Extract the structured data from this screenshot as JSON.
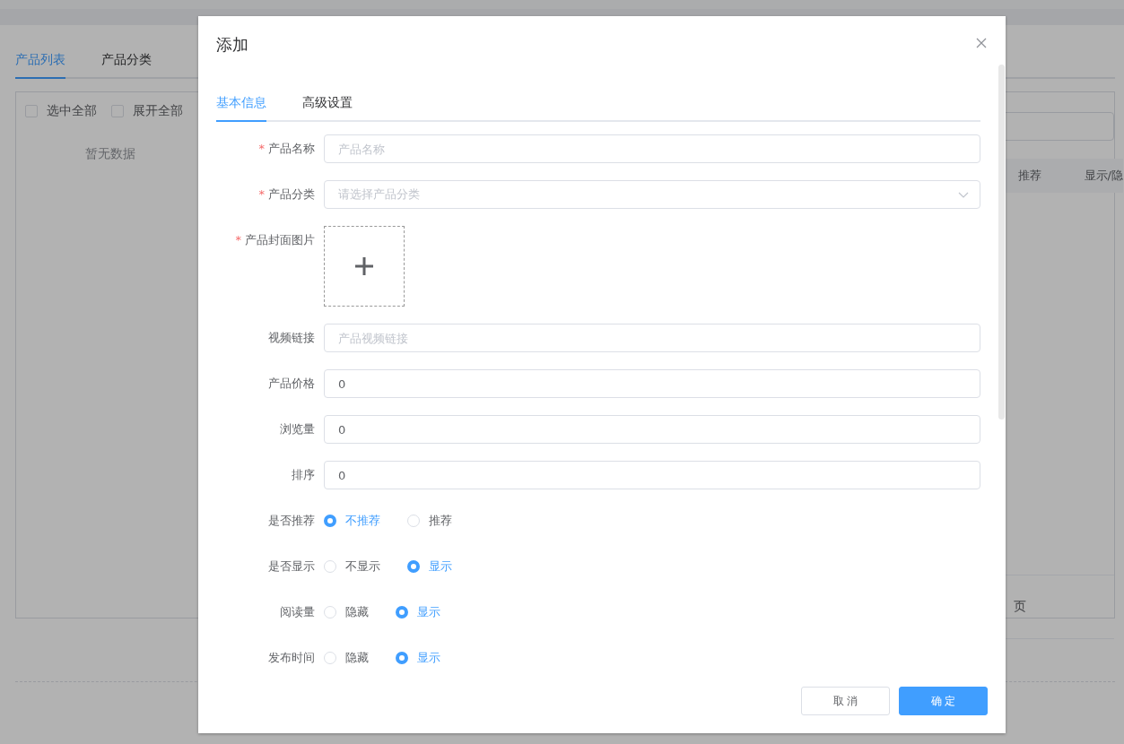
{
  "page": {
    "tabs": [
      {
        "label": "产品列表",
        "selected": true
      },
      {
        "label": "产品分类",
        "selected": false
      }
    ],
    "checkboxes": [
      {
        "label": "选中全部",
        "checked": false
      },
      {
        "label": "展开全部",
        "checked": false
      }
    ],
    "empty_text": "暂无数据",
    "table": {
      "columns": [
        "推荐",
        "显示/隐"
      ]
    },
    "pagination_text": "页"
  },
  "dialog": {
    "title": "添加",
    "required_mark": "*",
    "tabs": [
      {
        "label": "基本信息",
        "selected": true
      },
      {
        "label": "高级设置",
        "selected": false
      }
    ],
    "fields": [
      {
        "kind": "input",
        "label": "产品名称",
        "required": true,
        "placeholder": "产品名称"
      },
      {
        "kind": "select",
        "label": "产品分类",
        "required": true,
        "placeholder": "请选择产品分类"
      },
      {
        "kind": "upload",
        "label": "产品封面图片",
        "required": true
      },
      {
        "kind": "input",
        "label": "视频链接",
        "required": false,
        "placeholder": "产品视频链接"
      },
      {
        "kind": "input",
        "label": "产品价格",
        "required": false,
        "value": "0"
      },
      {
        "kind": "input",
        "label": "浏览量",
        "required": false,
        "value": "0"
      },
      {
        "kind": "input",
        "label": "排序",
        "required": false,
        "value": "0"
      },
      {
        "kind": "radio",
        "label": "是否推荐",
        "options": [
          {
            "label": "不推荐",
            "selected": true
          },
          {
            "label": "推荐",
            "selected": false
          }
        ]
      },
      {
        "kind": "radio",
        "label": "是否显示",
        "options": [
          {
            "label": "不显示",
            "selected": false
          },
          {
            "label": "显示",
            "selected": true
          }
        ]
      },
      {
        "kind": "radio",
        "label": "阅读量",
        "options": [
          {
            "label": "隐藏",
            "selected": false
          },
          {
            "label": "显示",
            "selected": true
          }
        ]
      },
      {
        "kind": "radio",
        "label": "发布时间",
        "options": [
          {
            "label": "隐藏",
            "selected": false
          },
          {
            "label": "显示",
            "selected": true
          }
        ]
      }
    ],
    "buttons": [
      {
        "label": "取 消",
        "kind": "default"
      },
      {
        "label": "确 定",
        "kind": "primary"
      }
    ]
  }
}
